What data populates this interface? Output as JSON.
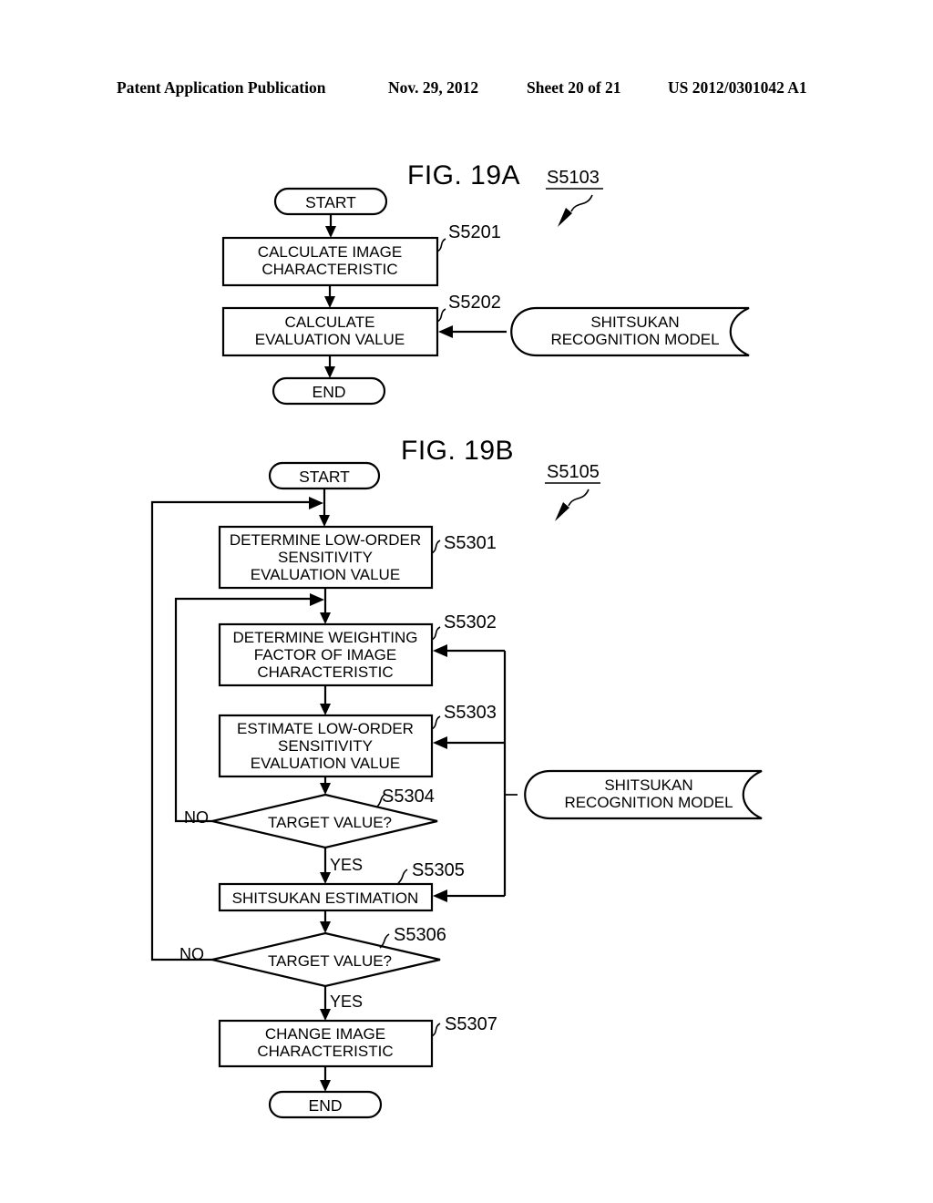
{
  "header": {
    "publication": "Patent Application Publication",
    "date": "Nov. 29, 2012",
    "sheet": "Sheet 20 of 21",
    "patent_number": "US 2012/0301042 A1"
  },
  "figures": [
    {
      "title": "FIG. 19A",
      "callout": "S5103",
      "nodes": [
        {
          "id": "a-start",
          "type": "terminator",
          "label": "START"
        },
        {
          "id": "a-s5201",
          "type": "process",
          "ref": "S5201",
          "lines": [
            "CALCULATE IMAGE",
            "CHARACTERISTIC"
          ]
        },
        {
          "id": "a-s5202",
          "type": "process",
          "ref": "S5202",
          "lines": [
            "CALCULATE",
            "EVALUATION VALUE"
          ]
        },
        {
          "id": "a-model",
          "type": "stored-data",
          "lines": [
            "SHITSUKAN",
            "RECOGNITION MODEL"
          ]
        },
        {
          "id": "a-end",
          "type": "terminator",
          "label": "END"
        }
      ]
    },
    {
      "title": "FIG. 19B",
      "callout": "S5105",
      "nodes": [
        {
          "id": "b-start",
          "type": "terminator",
          "label": "START"
        },
        {
          "id": "b-s5301",
          "type": "process",
          "ref": "S5301",
          "lines": [
            "DETERMINE LOW-ORDER",
            "SENSITIVITY",
            "EVALUATION VALUE"
          ]
        },
        {
          "id": "b-s5302",
          "type": "process",
          "ref": "S5302",
          "lines": [
            "DETERMINE WEIGHTING",
            "FACTOR OF IMAGE",
            "CHARACTERISTIC"
          ]
        },
        {
          "id": "b-s5303",
          "type": "process",
          "ref": "S5303",
          "lines": [
            "ESTIMATE LOW-ORDER",
            "SENSITIVITY",
            "EVALUATION VALUE"
          ]
        },
        {
          "id": "b-s5304",
          "type": "decision",
          "ref": "S5304",
          "lines": [
            "TARGET VALUE?"
          ],
          "no_label": "NO",
          "yes_label": "YES"
        },
        {
          "id": "b-s5305",
          "type": "process",
          "ref": "S5305",
          "lines": [
            "SHITSUKAN ESTIMATION"
          ]
        },
        {
          "id": "b-s5306",
          "type": "decision",
          "ref": "S5306",
          "lines": [
            "TARGET VALUE?"
          ],
          "no_label": "NO",
          "yes_label": "YES"
        },
        {
          "id": "b-s5307",
          "type": "process",
          "ref": "S5307",
          "lines": [
            "CHANGE IMAGE",
            "CHARACTERISTIC"
          ]
        },
        {
          "id": "b-model",
          "type": "stored-data",
          "lines": [
            "SHITSUKAN",
            "RECOGNITION MODEL"
          ]
        },
        {
          "id": "b-end",
          "type": "terminator",
          "label": "END"
        }
      ]
    }
  ],
  "colors": {
    "ink": "#000000",
    "paper": "#ffffff"
  }
}
